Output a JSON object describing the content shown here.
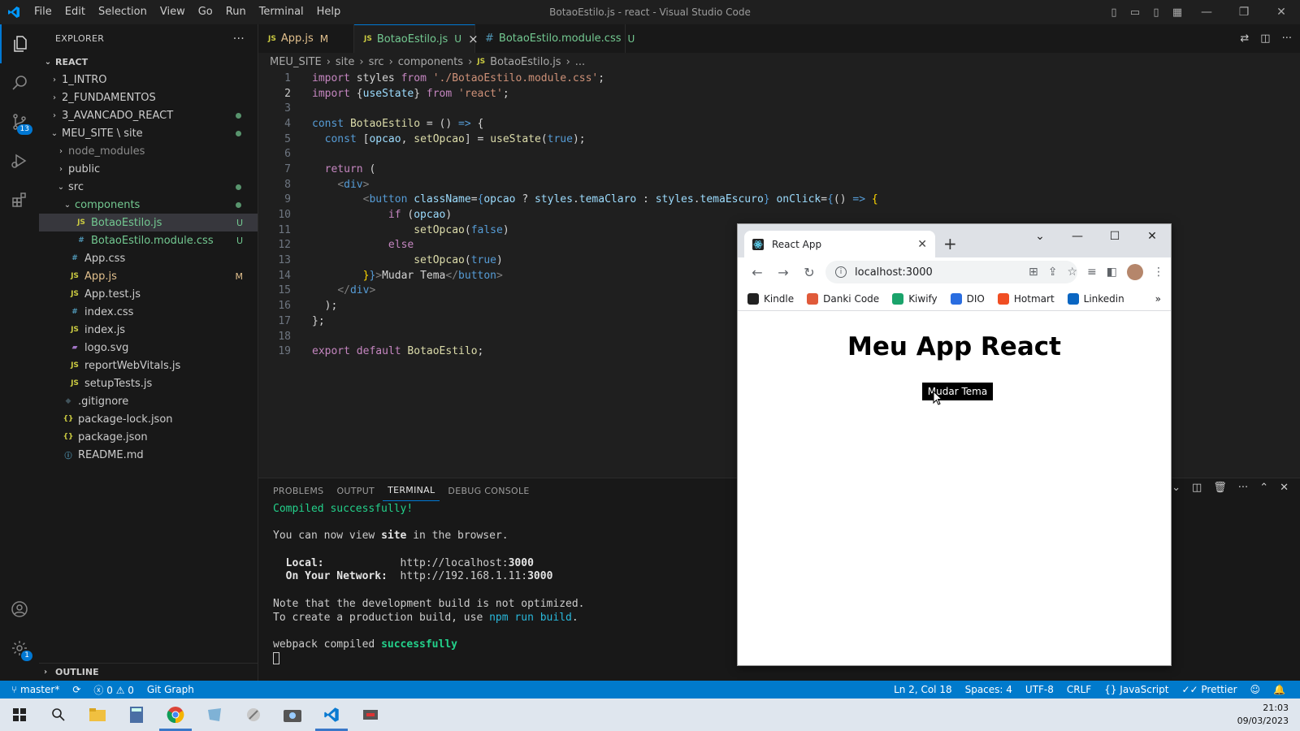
{
  "window": {
    "title": "BotaoEstilo.js - react - Visual Studio Code",
    "menu": [
      "File",
      "Edit",
      "Selection",
      "View",
      "Go",
      "Run",
      "Terminal",
      "Help"
    ]
  },
  "activity": {
    "source_control_badge": "13",
    "settings_badge": "1"
  },
  "sidebar": {
    "header": "EXPLORER",
    "more": "···",
    "root": "REACT",
    "items": [
      {
        "label": "1_INTRO",
        "indent": 1,
        "kind": "folder-closed"
      },
      {
        "label": "2_FUNDAMENTOS",
        "indent": 1,
        "kind": "folder-closed"
      },
      {
        "label": "3_AVANCADO_REACT",
        "indent": 1,
        "kind": "folder-closed",
        "modified": true
      },
      {
        "label": "MEU_SITE",
        "suffix": "\\ site",
        "indent": 1,
        "kind": "folder-open",
        "modified": true
      },
      {
        "label": "node_modules",
        "indent": 2,
        "kind": "folder-closed",
        "muted": true
      },
      {
        "label": "public",
        "indent": 2,
        "kind": "folder-closed"
      },
      {
        "label": "src",
        "indent": 2,
        "kind": "folder-open",
        "modified": true
      },
      {
        "label": "components",
        "indent": 3,
        "kind": "folder-open",
        "modified": true,
        "color": "#73c991"
      },
      {
        "label": "BotaoEstilo.js",
        "indent": 4,
        "kind": "js",
        "deco": "U",
        "color": "#73c991",
        "selected": true
      },
      {
        "label": "BotaoEstilo.module.css",
        "indent": 4,
        "kind": "css",
        "deco": "U",
        "color": "#73c991"
      },
      {
        "label": "App.css",
        "indent": 3,
        "kind": "css"
      },
      {
        "label": "App.js",
        "indent": 3,
        "kind": "js",
        "deco": "M",
        "color": "#e2c08d"
      },
      {
        "label": "App.test.js",
        "indent": 3,
        "kind": "js"
      },
      {
        "label": "index.css",
        "indent": 3,
        "kind": "css"
      },
      {
        "label": "index.js",
        "indent": 3,
        "kind": "js"
      },
      {
        "label": "logo.svg",
        "indent": 3,
        "kind": "svg"
      },
      {
        "label": "reportWebVitals.js",
        "indent": 3,
        "kind": "js"
      },
      {
        "label": "setupTests.js",
        "indent": 3,
        "kind": "js"
      },
      {
        "label": ".gitignore",
        "indent": 2,
        "kind": "git"
      },
      {
        "label": "package-lock.json",
        "indent": 2,
        "kind": "json"
      },
      {
        "label": "package.json",
        "indent": 2,
        "kind": "json"
      },
      {
        "label": "README.md",
        "indent": 2,
        "kind": "info"
      }
    ],
    "outline": "OUTLINE"
  },
  "tabs": [
    {
      "label": "App.js",
      "mark": "M",
      "kind": "js",
      "active": false
    },
    {
      "label": "BotaoEstilo.js",
      "mark": "U",
      "kind": "js",
      "active": true,
      "close": "×"
    },
    {
      "label": "BotaoEstilo.module.css",
      "mark": "U",
      "kind": "css",
      "active": false
    }
  ],
  "breadcrumb": [
    "MEU_SITE",
    "site",
    "src",
    "components",
    "BotaoEstilo.js",
    "..."
  ],
  "code_lines": [
    {
      "n": "1",
      "tokens": [
        [
          "kw",
          "import"
        ],
        [
          "plain",
          " styles "
        ],
        [
          "kw",
          "from"
        ],
        [
          "plain",
          " "
        ],
        [
          "str",
          "'./BotaoEstilo.module.css'"
        ],
        [
          "plain",
          ";"
        ]
      ]
    },
    {
      "n": "2",
      "tokens": [
        [
          "kw",
          "import"
        ],
        [
          "plain",
          " {"
        ],
        [
          "var",
          "useState"
        ],
        [
          "plain",
          "} "
        ],
        [
          "kw",
          "from"
        ],
        [
          "plain",
          " "
        ],
        [
          "str",
          "'react'"
        ],
        [
          "plain",
          ";"
        ]
      ]
    },
    {
      "n": "3",
      "tokens": []
    },
    {
      "n": "4",
      "tokens": [
        [
          "kw2",
          "const"
        ],
        [
          "plain",
          " "
        ],
        [
          "fn",
          "BotaoEstilo"
        ],
        [
          "plain",
          " = () "
        ],
        [
          "kw2",
          "=>"
        ],
        [
          "plain",
          " {"
        ]
      ]
    },
    {
      "n": "5",
      "tokens": [
        [
          "plain",
          "  "
        ],
        [
          "kw2",
          "const"
        ],
        [
          "plain",
          " ["
        ],
        [
          "var",
          "opcao"
        ],
        [
          "plain",
          ", "
        ],
        [
          "fn",
          "setOpcao"
        ],
        [
          "plain",
          "] = "
        ],
        [
          "fn",
          "useState"
        ],
        [
          "plain",
          "("
        ],
        [
          "kw2",
          "true"
        ],
        [
          "plain",
          ");"
        ]
      ]
    },
    {
      "n": "6",
      "tokens": []
    },
    {
      "n": "7",
      "tokens": [
        [
          "plain",
          "  "
        ],
        [
          "kw",
          "return"
        ],
        [
          "plain",
          " ("
        ]
      ]
    },
    {
      "n": "8",
      "tokens": [
        [
          "plain",
          "    "
        ],
        [
          "punc",
          "<"
        ],
        [
          "tag",
          "div"
        ],
        [
          "punc",
          ">"
        ]
      ]
    },
    {
      "n": "9",
      "tokens": [
        [
          "plain",
          "        "
        ],
        [
          "punc",
          "<"
        ],
        [
          "tag",
          "button"
        ],
        [
          "plain",
          " "
        ],
        [
          "attr",
          "className"
        ],
        [
          "plain",
          "="
        ],
        [
          "kw2",
          "{"
        ],
        [
          "var",
          "opcao"
        ],
        [
          "plain",
          " ? "
        ],
        [
          "var",
          "styles"
        ],
        [
          "plain",
          "."
        ],
        [
          "var",
          "temaClaro"
        ],
        [
          "plain",
          " : "
        ],
        [
          "var",
          "styles"
        ],
        [
          "plain",
          "."
        ],
        [
          "var",
          "temaEscuro"
        ],
        [
          "kw2",
          "}"
        ],
        [
          "plain",
          " "
        ],
        [
          "attr",
          "onClick"
        ],
        [
          "plain",
          "="
        ],
        [
          "kw2",
          "{"
        ],
        [
          "plain",
          "() "
        ],
        [
          "kw2",
          "=>"
        ],
        [
          "plain",
          " "
        ],
        [
          "gold",
          "{"
        ]
      ]
    },
    {
      "n": "10",
      "tokens": [
        [
          "plain",
          "            "
        ],
        [
          "kw",
          "if"
        ],
        [
          "plain",
          " ("
        ],
        [
          "var",
          "opcao"
        ],
        [
          "plain",
          ")"
        ]
      ]
    },
    {
      "n": "11",
      "tokens": [
        [
          "plain",
          "                "
        ],
        [
          "fn",
          "setOpcao"
        ],
        [
          "plain",
          "("
        ],
        [
          "kw2",
          "false"
        ],
        [
          "plain",
          ")"
        ]
      ]
    },
    {
      "n": "12",
      "tokens": [
        [
          "plain",
          "            "
        ],
        [
          "kw",
          "else"
        ]
      ]
    },
    {
      "n": "13",
      "tokens": [
        [
          "plain",
          "                "
        ],
        [
          "fn",
          "setOpcao"
        ],
        [
          "plain",
          "("
        ],
        [
          "kw2",
          "true"
        ],
        [
          "plain",
          ")"
        ]
      ]
    },
    {
      "n": "14",
      "tokens": [
        [
          "plain",
          "        "
        ],
        [
          "gold",
          "}"
        ],
        [
          "kw2",
          "}"
        ],
        [
          "punc",
          ">"
        ],
        [
          "plain",
          "Mudar Tema"
        ],
        [
          "punc",
          "</"
        ],
        [
          "tag",
          "button"
        ],
        [
          "punc",
          ">"
        ]
      ]
    },
    {
      "n": "15",
      "tokens": [
        [
          "plain",
          "    "
        ],
        [
          "punc",
          "</"
        ],
        [
          "tag",
          "div"
        ],
        [
          "punc",
          ">"
        ]
      ]
    },
    {
      "n": "16",
      "tokens": [
        [
          "plain",
          "  );"
        ]
      ]
    },
    {
      "n": "17",
      "tokens": [
        [
          "plain",
          "};"
        ]
      ]
    },
    {
      "n": "18",
      "tokens": []
    },
    {
      "n": "19",
      "tokens": [
        [
          "kw",
          "export"
        ],
        [
          "plain",
          " "
        ],
        [
          "kw",
          "default"
        ],
        [
          "plain",
          " "
        ],
        [
          "fn",
          "BotaoEstilo"
        ],
        [
          "plain",
          ";"
        ]
      ]
    }
  ],
  "panel": {
    "tabs": [
      "PROBLEMS",
      "OUTPUT",
      "TERMINAL",
      "DEBUG CONSOLE"
    ],
    "active": "TERMINAL",
    "compiled": "Compiled successfully!",
    "view_prefix": "You can now view ",
    "view_app": "site",
    "view_suffix": " in the browser.",
    "local_label": "  Local:            ",
    "local_url_prefix": "http://localhost:",
    "local_port": "3000",
    "network_label": "  On Your Network:  ",
    "network_url_prefix": "http://192.168.1.11:",
    "network_port": "3000",
    "note1": "Note that the development build is not optimized.",
    "note2_prefix": "To create a production build, use ",
    "note2_cmd": "npm run build",
    "note2_suffix": ".",
    "webpack_prefix": "webpack compiled ",
    "webpack_status": "successfully"
  },
  "statusbar": {
    "branch": "master*",
    "errors": "0",
    "warnings": "0",
    "git_graph": "Git Graph",
    "position": "Ln 2, Col 18",
    "spaces": "Spaces: 4",
    "encoding": "UTF-8",
    "eol": "CRLF",
    "language": "JavaScript",
    "prettier": "Prettier"
  },
  "browser": {
    "tab_title": "React App",
    "url": "localhost:3000",
    "bookmarks": [
      {
        "label": "Kindle",
        "color": "#222222"
      },
      {
        "label": "Danki Code",
        "color": "#e05a3a"
      },
      {
        "label": "Kiwify",
        "color": "#1aa36b"
      },
      {
        "label": "DIO",
        "color": "#2a6de0"
      },
      {
        "label": "Hotmart",
        "color": "#f04e23"
      },
      {
        "label": "Linkedin",
        "color": "#0a66c2"
      }
    ],
    "more_bookmarks": "»",
    "app_heading": "Meu App React",
    "app_button": "Mudar Tema"
  },
  "taskbar": {
    "time": "21:03",
    "date": "09/03/2023"
  }
}
